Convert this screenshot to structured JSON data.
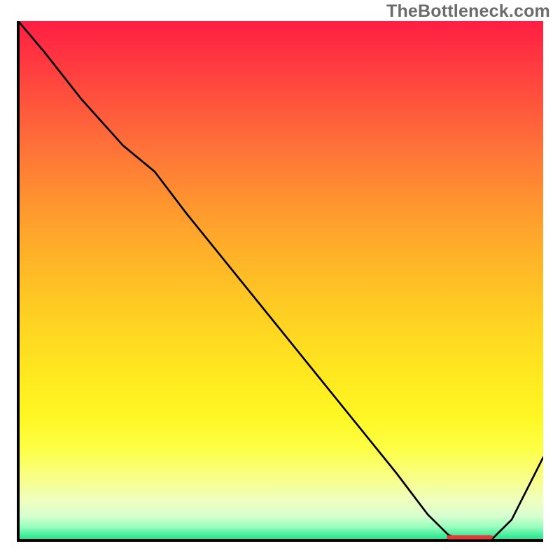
{
  "watermark": "TheBottleneck.com",
  "colors": {
    "curve": "#000000",
    "accent": "#e03a3a",
    "axis": "#000000"
  },
  "chart_data": {
    "type": "line",
    "title": "",
    "xlabel": "",
    "ylabel": "",
    "xlim": [
      0,
      100
    ],
    "ylim": [
      0,
      100
    ],
    "x": [
      0,
      5,
      12,
      20,
      26,
      32,
      40,
      48,
      56,
      64,
      72,
      78,
      82,
      86,
      90,
      94,
      100
    ],
    "values": [
      100,
      94,
      85,
      76,
      71,
      63,
      53,
      43,
      33,
      23,
      13,
      5,
      1,
      0,
      0,
      4,
      16
    ],
    "accent_range_x": [
      82,
      90
    ],
    "accent_y": 0.6
  }
}
